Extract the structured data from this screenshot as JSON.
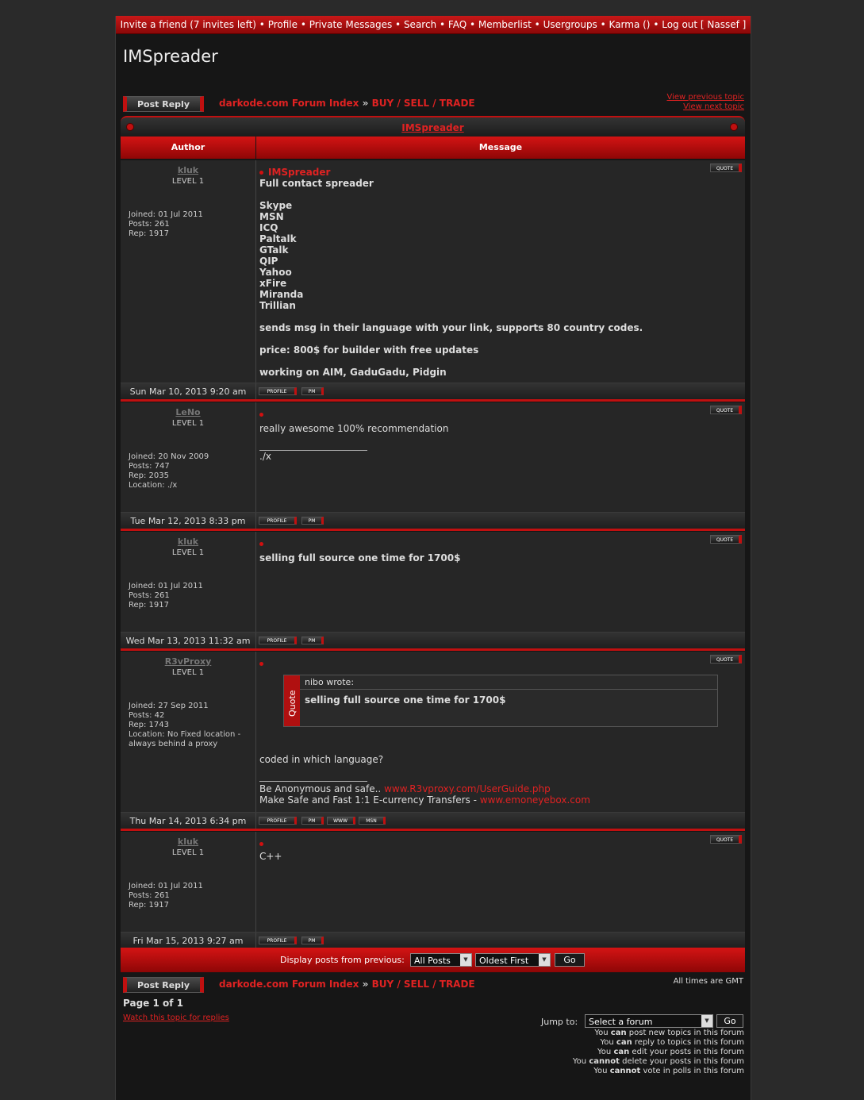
{
  "topnav": {
    "invite": "Invite a friend (7 invites left)",
    "profile": "Profile",
    "pm": "Private Messages",
    "search": "Search",
    "faq": "FAQ",
    "memberlist": "Memberlist",
    "usergroups": "Usergroups",
    "karma": "Karma ()",
    "logout": "Log out [ Nassef ]"
  },
  "page_title": "IMSpreader",
  "post_reply": "Post Reply",
  "breadcrumb": {
    "index": "darkode.com Forum Index",
    "sep": "»",
    "forum": "BUY / SELL / TRADE"
  },
  "view_previous": "View previous topic",
  "view_next": "View next topic",
  "topic_title": "IMSpreader",
  "columns": {
    "author": "Author",
    "message": "Message"
  },
  "buttons": {
    "quote": "QUOTE",
    "profile": "PROFILE",
    "pm": "PM",
    "www": "WWW",
    "msn": "MSN"
  },
  "posts": [
    {
      "author": "kluk",
      "level": "LEVEL 1",
      "info": [
        "Joined: 01 Jul 2011",
        "Posts: 261",
        "Rep: 1917"
      ],
      "subject": "IMSpreader",
      "lines": [
        "Full contact spreader",
        "",
        "Skype",
        "MSN",
        "ICQ",
        "Paltalk",
        "GTalk",
        "QIP",
        "Yahoo",
        "xFire",
        "Miranda",
        "Trillian",
        "",
        "sends msg in their language with your link, supports 80 country codes.",
        "",
        "price: 800$ for builder with free updates",
        "",
        "working on AIM, GaduGadu, Pidgin"
      ],
      "date": "Sun Mar 10, 2013 9:20 am"
    },
    {
      "author": "LeNo",
      "level": "LEVEL 1",
      "info": [
        "Joined: 20 Nov 2009",
        "Posts: 747",
        "Rep: 2035",
        "Location: ./x"
      ],
      "text": "really awesome 100% recommendation",
      "sig": "./x",
      "date": "Tue Mar 12, 2013 8:33 pm"
    },
    {
      "author": "kluk",
      "level": "LEVEL 1",
      "info": [
        "Joined: 01 Jul 2011",
        "Posts: 261",
        "Rep: 1917"
      ],
      "text": "selling full source one time for 1700$",
      "date": "Wed Mar 13, 2013 11:32 am"
    },
    {
      "author": "R3vProxy",
      "level": "LEVEL 1",
      "info": [
        "Joined: 27 Sep 2011",
        "Posts: 42",
        "Rep: 1743",
        "Location: No Fixed location - always behind a proxy"
      ],
      "quote_label": "Quote",
      "quote_author": "nibo wrote:",
      "quote_text": "selling full source one time for 1700$",
      "text": "coded in which language?",
      "sig1_prefix": "Be Anonymous and safe..",
      "sig1_link": "www.R3vproxy.com/UserGuide.php",
      "sig2_prefix": "Make Safe and Fast 1:1 E-currency Transfers -",
      "sig2_link": "www.emoneyebox.com",
      "date": "Thu Mar 14, 2013 6:34 pm"
    },
    {
      "author": "kluk",
      "level": "LEVEL 1",
      "info": [
        "Joined: 01 Jul 2011",
        "Posts: 261",
        "Rep: 1917"
      ],
      "text": "C++",
      "date": "Fri Mar 15, 2013 9:27 am"
    }
  ],
  "display": {
    "label": "Display posts from previous:",
    "posts_value": "All Posts",
    "order_value": "Oldest First",
    "go": "Go"
  },
  "timezone": "All times are GMT",
  "page_of": "Page 1 of 1",
  "watch": "Watch this topic for replies",
  "jump": {
    "label": "Jump to:",
    "value": "Select a forum",
    "go": "Go"
  },
  "permissions": [
    {
      "pre": "You",
      "key": "can",
      "post": "post new topics in this forum"
    },
    {
      "pre": "You",
      "key": "can",
      "post": "reply to topics in this forum"
    },
    {
      "pre": "You",
      "key": "can",
      "post": "edit your posts in this forum"
    },
    {
      "pre": "You",
      "key": "cannot",
      "post": "delete your posts in this forum"
    },
    {
      "pre": "You",
      "key": "cannot",
      "post": "vote in polls in this forum"
    }
  ],
  "colors": {
    "accent": "#c01010",
    "link": "#e02222",
    "bg": "#161616"
  }
}
